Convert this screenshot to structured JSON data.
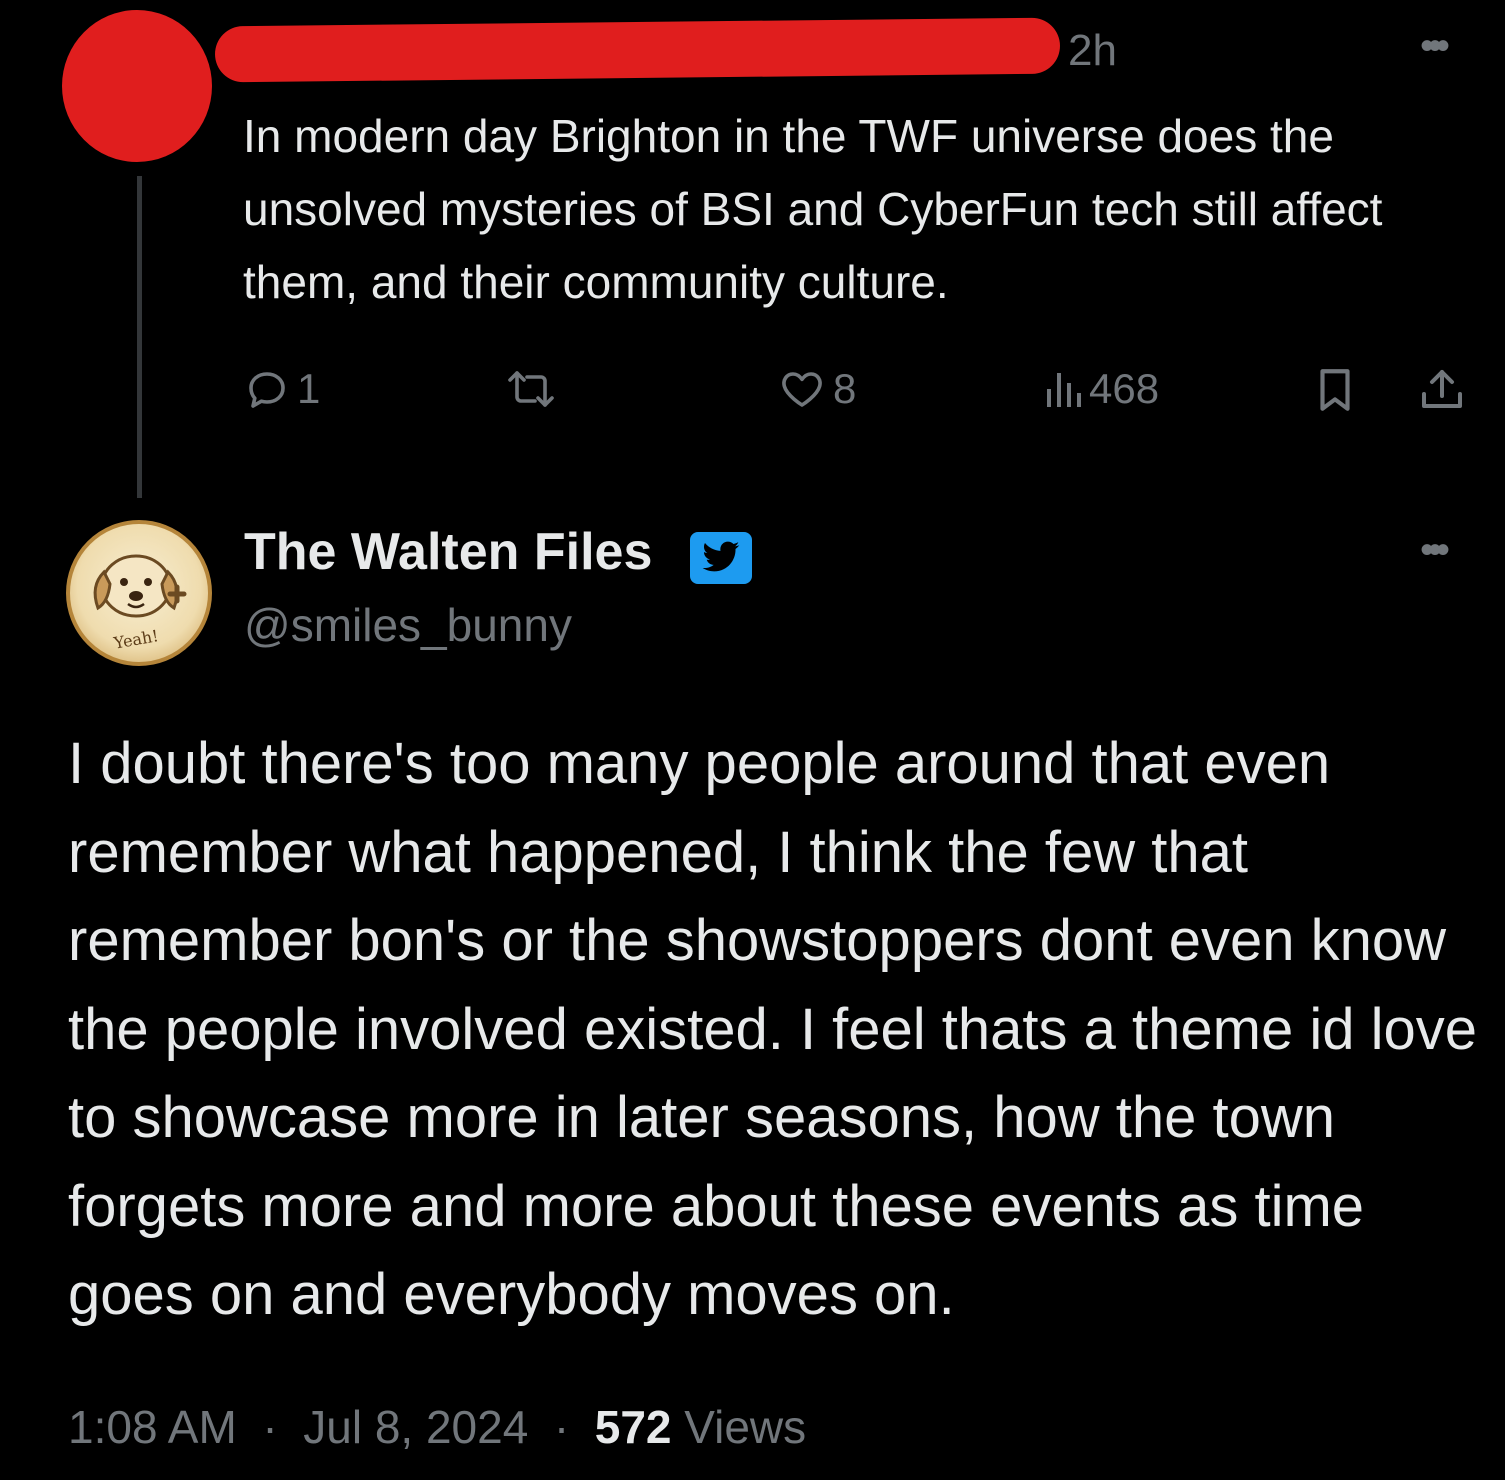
{
  "parent_tweet": {
    "time": "2h",
    "text": "In modern day Brighton in the TWF universe does the unsolved mysteries of BSI and CyberFun tech still affect them, and their community culture.",
    "actions": {
      "reply_count": "1",
      "retweet_count": "",
      "like_count": "8",
      "views_count": "468"
    }
  },
  "main_tweet": {
    "display_name": "The Walten Files",
    "handle": "@smiles_bunny",
    "avatar_caption": "Yeah!",
    "text": "I doubt there's too many people around that even remember what happened, I think the few that remember bon's or the showstoppers dont even know the people involved existed. I feel thats a theme id love to showcase more in later seasons, how the town forgets more and more about these events as time goes on and everybody moves on.",
    "time": "1:08 AM",
    "date": "Jul 8, 2024",
    "views_count": "572",
    "views_label": "Views"
  },
  "colors": {
    "background": "#000000",
    "text_primary": "#e7e9ea",
    "text_secondary": "#71767b",
    "verified_blue": "#1d9bf0",
    "redaction_red": "#e01e1e"
  }
}
